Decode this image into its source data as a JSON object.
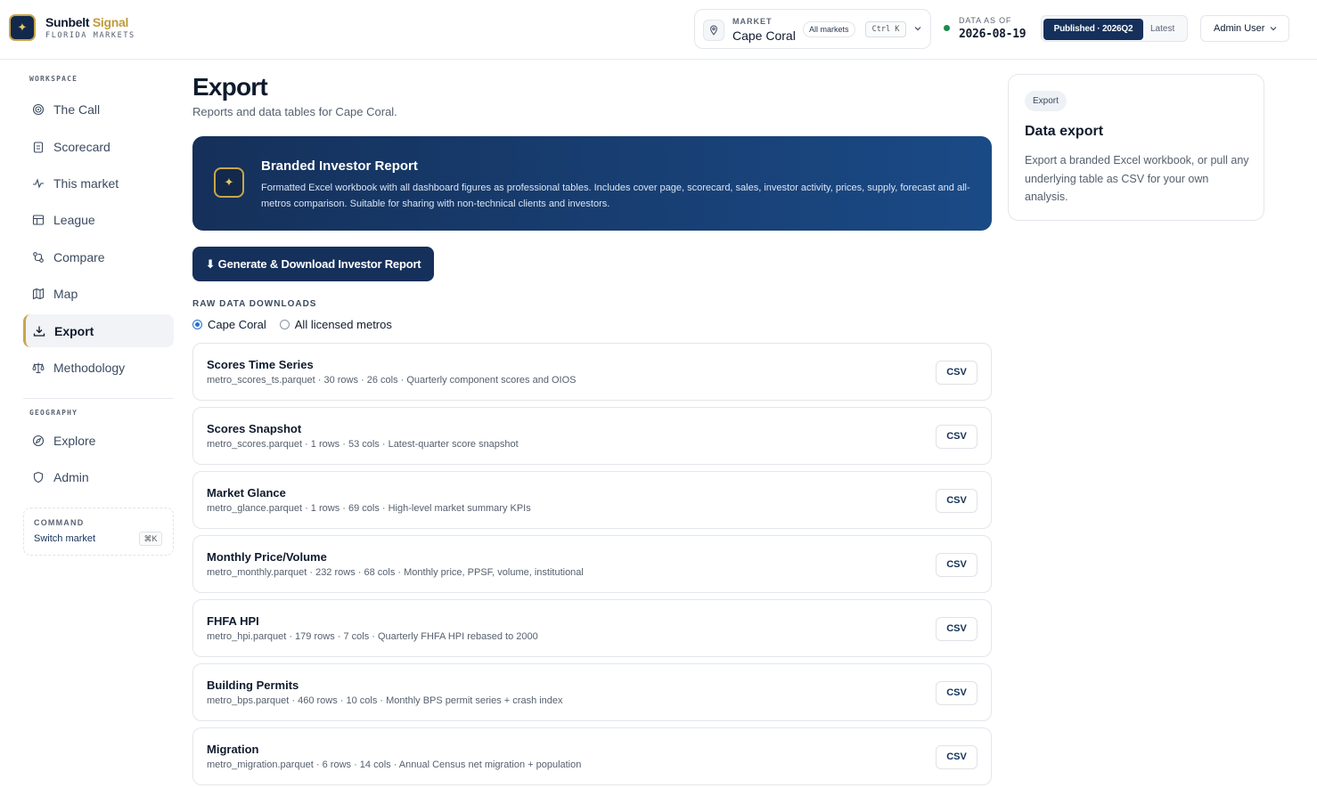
{
  "brand": {
    "name_primary": "Sunbelt",
    "name_accent": "Signal",
    "subtitle": "FLORIDA MARKETS"
  },
  "header": {
    "market_label": "MARKET",
    "market_value": "Cape Coral",
    "all_markets": "All markets",
    "shortcut": "Ctrl K",
    "asof_label": "DATA AS OF",
    "asof_value": "2026-08-19",
    "status_color": "#1f8a4c",
    "published": "Published · 2026Q2",
    "latest": "Latest",
    "user": "Admin User"
  },
  "sidebar": {
    "workspace_label": "WORKSPACE",
    "workspace": [
      {
        "label": "The Call",
        "icon": "target-icon"
      },
      {
        "label": "Scorecard",
        "icon": "clipboard-icon"
      },
      {
        "label": "This market",
        "icon": "activity-icon"
      },
      {
        "label": "League",
        "icon": "table-icon"
      },
      {
        "label": "Compare",
        "icon": "compare-icon"
      },
      {
        "label": "Map",
        "icon": "map-icon"
      },
      {
        "label": "Export",
        "icon": "download-icon",
        "active": true
      },
      {
        "label": "Methodology",
        "icon": "scale-icon"
      }
    ],
    "geography_label": "GEOGRAPHY",
    "geography": [
      {
        "label": "Explore",
        "icon": "compass-icon"
      },
      {
        "label": "Admin",
        "icon": "shield-icon"
      }
    ],
    "command": {
      "label": "COMMAND",
      "value": "Switch market",
      "kbd": "⌘K"
    }
  },
  "main": {
    "title": "Export",
    "subtitle": "Reports and data tables for Cape Coral.",
    "banner": {
      "title": "Branded Investor Report",
      "description": "Formatted Excel workbook with all dashboard figures as professional tables. Includes cover page, scorecard, sales, investor activity, prices, supply, forecast and all-metros comparison. Suitable for sharing with non-technical clients and investors."
    },
    "generate_button": "⬇ Generate & Download Investor Report",
    "raw_label": "RAW DATA DOWNLOADS",
    "radio_options": [
      {
        "label": "Cape Coral",
        "checked": true
      },
      {
        "label": "All licensed metros",
        "checked": false
      }
    ],
    "csv_label": "CSV",
    "files": [
      {
        "name": "Scores Time Series",
        "meta": "metro_scores_ts.parquet · 30 rows · 26 cols · Quarterly component scores and OIOS"
      },
      {
        "name": "Scores Snapshot",
        "meta": "metro_scores.parquet · 1 rows · 53 cols · Latest-quarter score snapshot"
      },
      {
        "name": "Market Glance",
        "meta": "metro_glance.parquet · 1 rows · 69 cols · High-level market summary KPIs"
      },
      {
        "name": "Monthly Price/Volume",
        "meta": "metro_monthly.parquet · 232 rows · 68 cols · Monthly price, PPSF, volume, institutional"
      },
      {
        "name": "FHFA HPI",
        "meta": "metro_hpi.parquet · 179 rows · 7 cols · Quarterly FHFA HPI rebased to 2000"
      },
      {
        "name": "Building Permits",
        "meta": "metro_bps.parquet · 460 rows · 10 cols · Monthly BPS permit series + crash index"
      },
      {
        "name": "Migration",
        "meta": "metro_migration.parquet · 6 rows · 14 cols · Annual Census net migration + population"
      }
    ]
  },
  "side_panel": {
    "badge": "Export",
    "title": "Data export",
    "description": "Export a branded Excel workbook, or pull any underlying table as CSV for your own analysis."
  }
}
